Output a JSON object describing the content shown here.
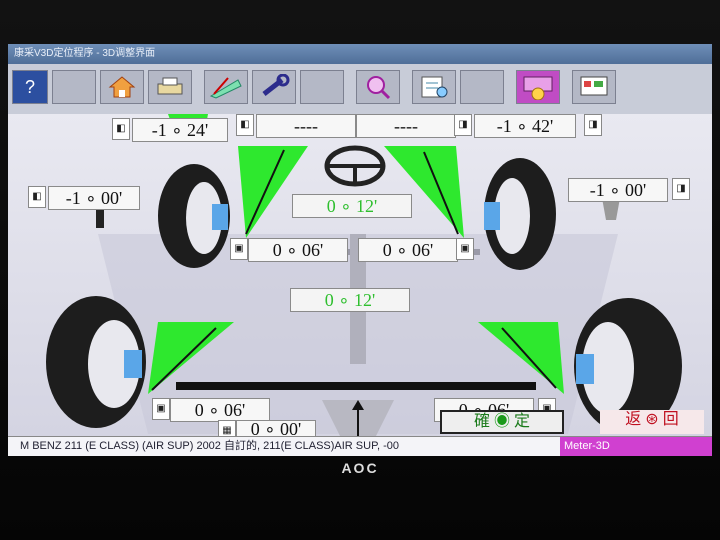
{
  "window": {
    "title": "康采V3D定位程序 - 3D调整界面"
  },
  "readouts": {
    "front_left_camber": "-1 ∘ 24'",
    "front_left_caster": "----",
    "front_right_caster": "----",
    "front_right_camber": "-1 ∘ 42'",
    "rear_left_camber": "-1 ∘ 00'",
    "rear_right_camber": "-1 ∘ 00'",
    "front_total_toe": "0 ∘ 12'",
    "front_left_toe": "0 ∘ 06'",
    "front_right_toe": "0 ∘ 06'",
    "rear_total_toe": "0 ∘ 12'",
    "rear_left_toe": "0 ∘ 06'",
    "rear_right_toe": "0 ∘ 06'",
    "thrust_angle": "0 ∘ 00'"
  },
  "buttons": {
    "confirm_left": "確",
    "confirm_right": "定",
    "back_left": "返",
    "back_right": "回"
  },
  "status": {
    "vehicle": "M BENZ 211 (E CLASS) (AIR SUP) 2002 自訂的, 211(E CLASS)AIR SUP, -00",
    "mode": "Meter-3D"
  },
  "monitor": {
    "brand": "AOC"
  },
  "colors": {
    "indicator_green": "#2ee82e",
    "indicator_red": "#e8463a",
    "mode_bar": "#d040d0"
  }
}
